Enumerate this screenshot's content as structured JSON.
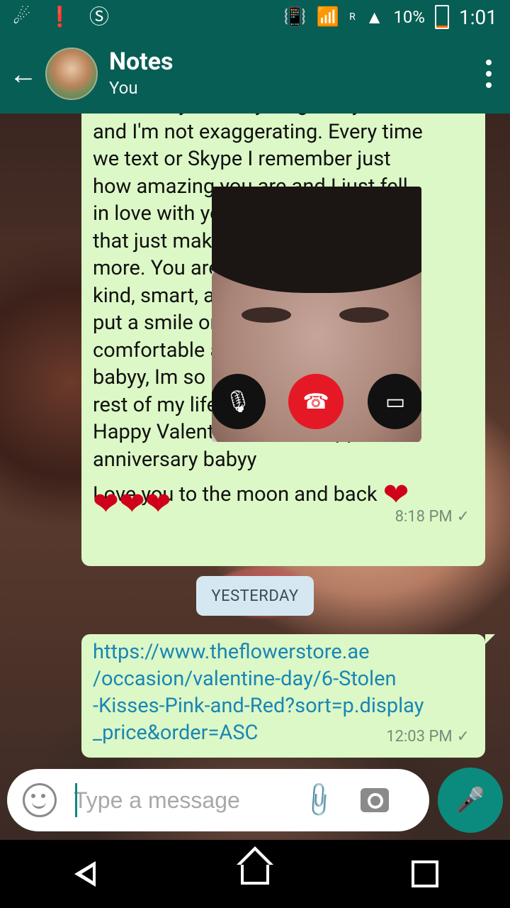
{
  "status_bar": {
    "icons": [
      "notification-icon",
      "alert-icon",
      "skype-icon"
    ],
    "signal_label": "R",
    "battery": "10%",
    "time": "1:01"
  },
  "app_bar": {
    "title": "Notes",
    "subtitle": "You"
  },
  "messages": [
    {
      "text": "love with you every single day wedad,\nand I'm not exaggerating. Every time\nwe text or Skype I remember just\nhow amazing you are and I just fell\nin love with you all over again and\nthat just makes me love you even\nmore. You are beautiful, funny,\nkind, smart, and you always\nput a smile on my face. I feel\ncomfortable and at home with you\nbabyy, Im so happy to spend the\nrest of my life with you.\nHappy Valentines and a happier\nanniversary babyy",
      "line2": "Love you to the moon and back",
      "hearts": "❤❤❤",
      "time": "8:18 PM"
    },
    {
      "text": "https://www.theflowerstore.ae\n/occasion/valentine-day/6-Stolen\n-Kisses-Pink-and-Red?sort=p.display\n_price&order=ASC",
      "time": "12:03 PM"
    }
  ],
  "date_divider": "YESTERDAY",
  "input": {
    "placeholder": "Type a message"
  }
}
